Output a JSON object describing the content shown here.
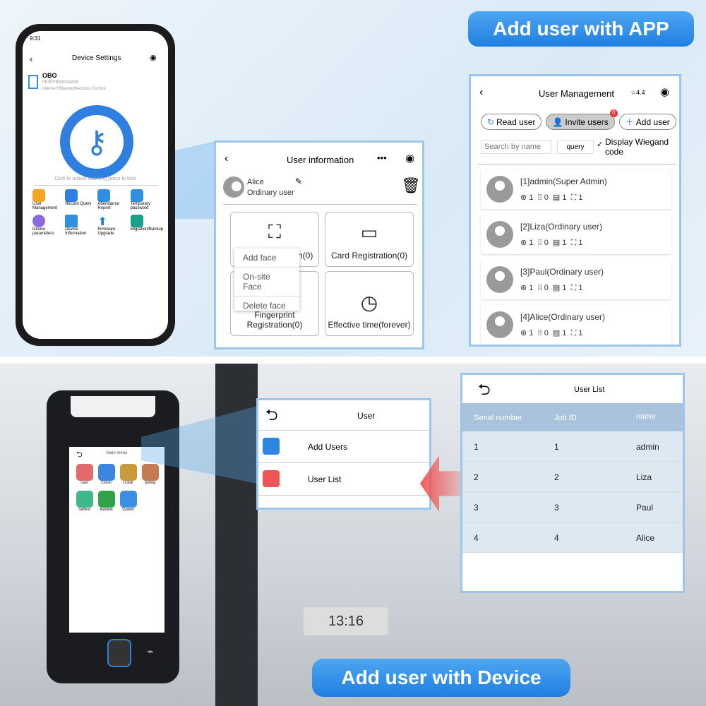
{
  "banners": {
    "app": "Add user with APP",
    "device": "Add user with Device"
  },
  "phone": {
    "time": "9:31",
    "title": "Device Settings",
    "device_name": "OBO",
    "device_id": "FE0EFB0000AB98",
    "device_type": "Internet+BluetoothAccess Control",
    "unlock_hint": "Click to unlock and long press to lock",
    "menu": [
      {
        "label": "User Management",
        "color": "#f3a623"
      },
      {
        "label": "Record Query",
        "color": "#2f7fe0"
      },
      {
        "label": "Attendance Report",
        "color": "#2f8fe0"
      },
      {
        "label": "Temporary password",
        "color": "#2f8fe0"
      },
      {
        "label": "Device parameters",
        "color": "#8a6ae0"
      },
      {
        "label": "Device Information",
        "color": "#2f8fe0"
      },
      {
        "label": "Firmware Upgrade",
        "color": "#1f78d0"
      },
      {
        "label": "Migration/Backup",
        "color": "#1aa08a"
      }
    ]
  },
  "user_info": {
    "title": "User information",
    "name": "Alice",
    "role": "Ordinary user",
    "cards": [
      "Face Registration(0)",
      "Card Registration(0)",
      "Fingerprint Registration(0)",
      "Effective time(forever)"
    ],
    "face_menu": [
      "Add face",
      "On-site Face",
      "Delete face"
    ]
  },
  "user_mgmt": {
    "title": "User Management",
    "version": "4.4",
    "buttons": {
      "read": "Read user",
      "invite": "Invite users",
      "invite_badge": "0",
      "add": "Add user"
    },
    "search_placeholder": "Search by name",
    "query": "query",
    "wiegand": "Display Wiegand code",
    "users": [
      {
        "name": "[1]admin(Super Admin)",
        "counts": [
          "1",
          "0",
          "1",
          "1"
        ]
      },
      {
        "name": "[2]Liza(Ordinary user)",
        "counts": [
          "1",
          "0",
          "1",
          "1"
        ]
      },
      {
        "name": "[3]Paul(Ordinary user)",
        "counts": [
          "1",
          "0",
          "1",
          "1"
        ]
      },
      {
        "name": "[4]Alice(Ordinary user)",
        "counts": [
          "1",
          "0",
          "1",
          "1"
        ]
      }
    ]
  },
  "device": {
    "title": "Main menu",
    "apps": [
      {
        "label": "User",
        "color": "#e36a6a"
      },
      {
        "label": "Comm",
        "color": "#3a86e0"
      },
      {
        "label": "U disk",
        "color": "#c99a3a"
      },
      {
        "label": "Setting",
        "color": "#c57a50"
      },
      {
        "label": "Selftest",
        "color": "#3fb98a"
      },
      {
        "label": "Autotest",
        "color": "#2fa24a"
      },
      {
        "label": "System",
        "color": "#3a8fe0"
      }
    ]
  },
  "user_menu": {
    "title": "User",
    "items": [
      "Add Users",
      "User List"
    ]
  },
  "user_list": {
    "title": "User List",
    "headers": [
      "Serial number",
      "Job ID",
      "name"
    ],
    "rows": [
      [
        "1",
        "1",
        "admin"
      ],
      [
        "2",
        "2",
        "Liza"
      ],
      [
        "3",
        "3",
        "Paul"
      ],
      [
        "4",
        "4",
        "Alice"
      ]
    ]
  },
  "clock": "13:16"
}
